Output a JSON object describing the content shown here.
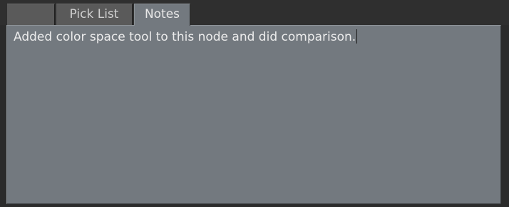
{
  "tabs": [
    {
      "label": ""
    },
    {
      "label": "Pick List"
    },
    {
      "label": "Notes"
    }
  ],
  "active_tab": "Notes",
  "notes": {
    "text": "Added color space tool to this node and did comparison."
  },
  "colors": {
    "background": "#2b2b2b",
    "inactive_tab": "#5a5a5a",
    "active_tab": "#73797f",
    "text": "#ececec"
  }
}
